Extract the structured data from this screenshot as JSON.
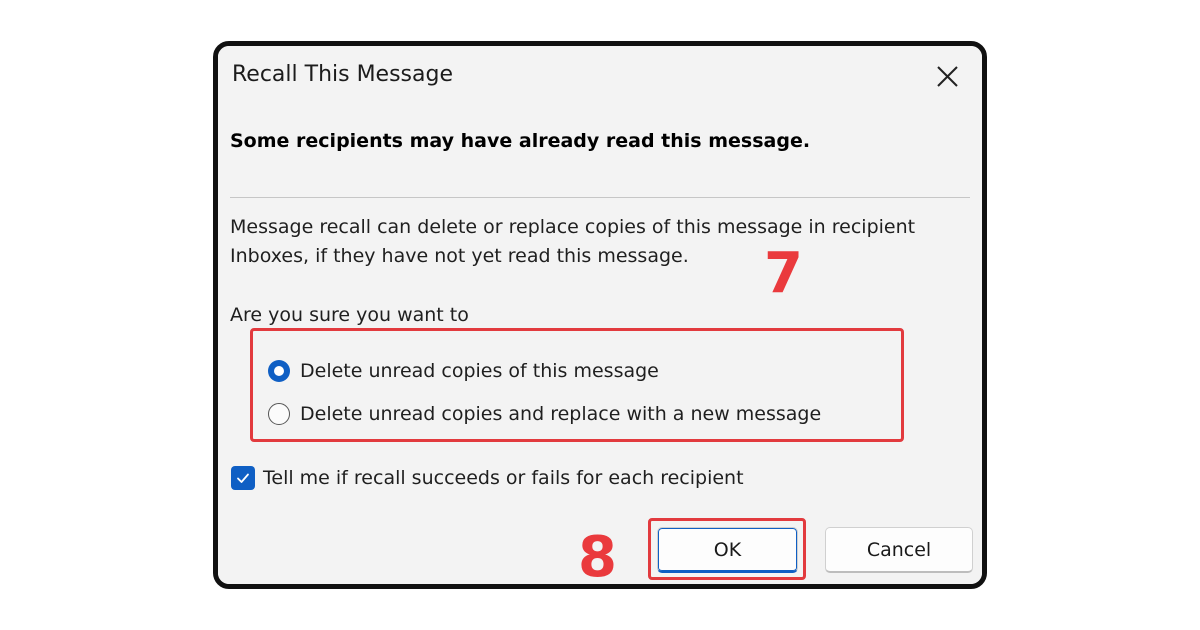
{
  "dialog": {
    "title": "Recall This Message",
    "close_icon": "close-icon",
    "warning": "Some recipients may have already read this message.",
    "description_line1": "Message recall can delete or replace copies of this message in recipient",
    "description_line2": "Inboxes, if they have not yet read this message.",
    "question": "Are you sure you want to",
    "options": [
      {
        "label": "Delete unread copies of this message",
        "selected": true
      },
      {
        "label": "Delete unread copies and replace with a new message",
        "selected": false
      }
    ],
    "notify_checkbox": {
      "label": "Tell me if recall succeeds or fails for each recipient",
      "checked": true
    },
    "ok_label": "OK",
    "cancel_label": "Cancel"
  },
  "annotations": {
    "step_options": "7",
    "step_ok": "8",
    "highlight_color": "#e23a3e"
  },
  "colors": {
    "accent": "#0f5fc4",
    "dialog_background": "#f3f3f3",
    "annotation": "#ea3a3d"
  }
}
